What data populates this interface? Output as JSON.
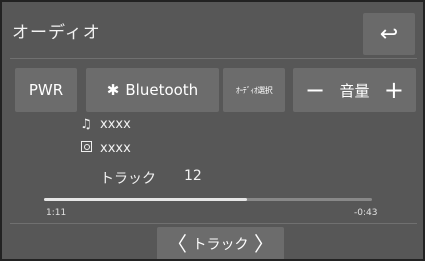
{
  "header": {
    "title": "オーディオ",
    "back_icon": "↩"
  },
  "buttons": {
    "power_label": "PWR",
    "source_icon": "✱",
    "source_label": "Bluetooth",
    "audio_select_label": "ｵｰﾃﾞｨｵ選択",
    "volume": {
      "minus": "−",
      "label": "音量",
      "plus": "+"
    }
  },
  "track_info": {
    "title": "xxxx",
    "album": "xxxx",
    "track_label": "トラック",
    "track_number": "12"
  },
  "playback": {
    "elapsed": "1:11",
    "remaining": "-0:43",
    "progress_fraction": 0.62
  },
  "track_nav": {
    "prev": "〈",
    "label": "トラック",
    "next": "〉"
  }
}
